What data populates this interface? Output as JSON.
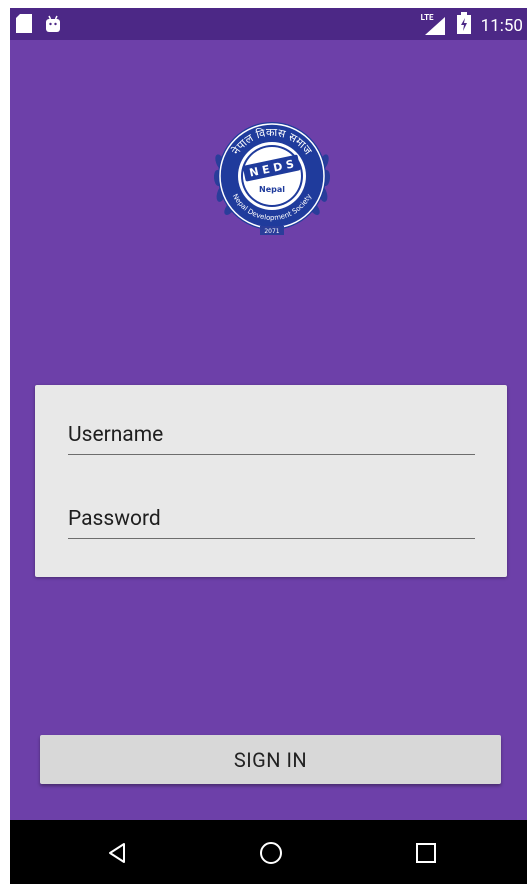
{
  "status_bar": {
    "time": "11:50",
    "network_label": "LTE",
    "icons": [
      "sd-card-icon",
      "android-icon",
      "lte-signal-icon",
      "battery-icon"
    ]
  },
  "logo": {
    "name": "neds-nepal-logo",
    "ring_top_text": "नेपाल विकास समाज",
    "center_text": "N E D S",
    "inner_text": "Nepal",
    "ring_bottom_text": "Nepal Development Society",
    "year": "2071",
    "colors": {
      "ring": "#1f3b9c",
      "laurel": "#2a3d9a",
      "inner": "#ffffff"
    }
  },
  "login_form": {
    "username": {
      "value": "",
      "placeholder": "Username"
    },
    "password": {
      "value": "",
      "placeholder": "Password"
    }
  },
  "actions": {
    "sign_in_label": "SIGN IN"
  },
  "nav_bar": {
    "icons": [
      "back-icon",
      "home-icon",
      "recents-icon"
    ]
  },
  "colors": {
    "background": "#6d40a9",
    "status_bar": "#4c2886",
    "card": "#e8e8e8",
    "button": "#d8d8d8"
  }
}
